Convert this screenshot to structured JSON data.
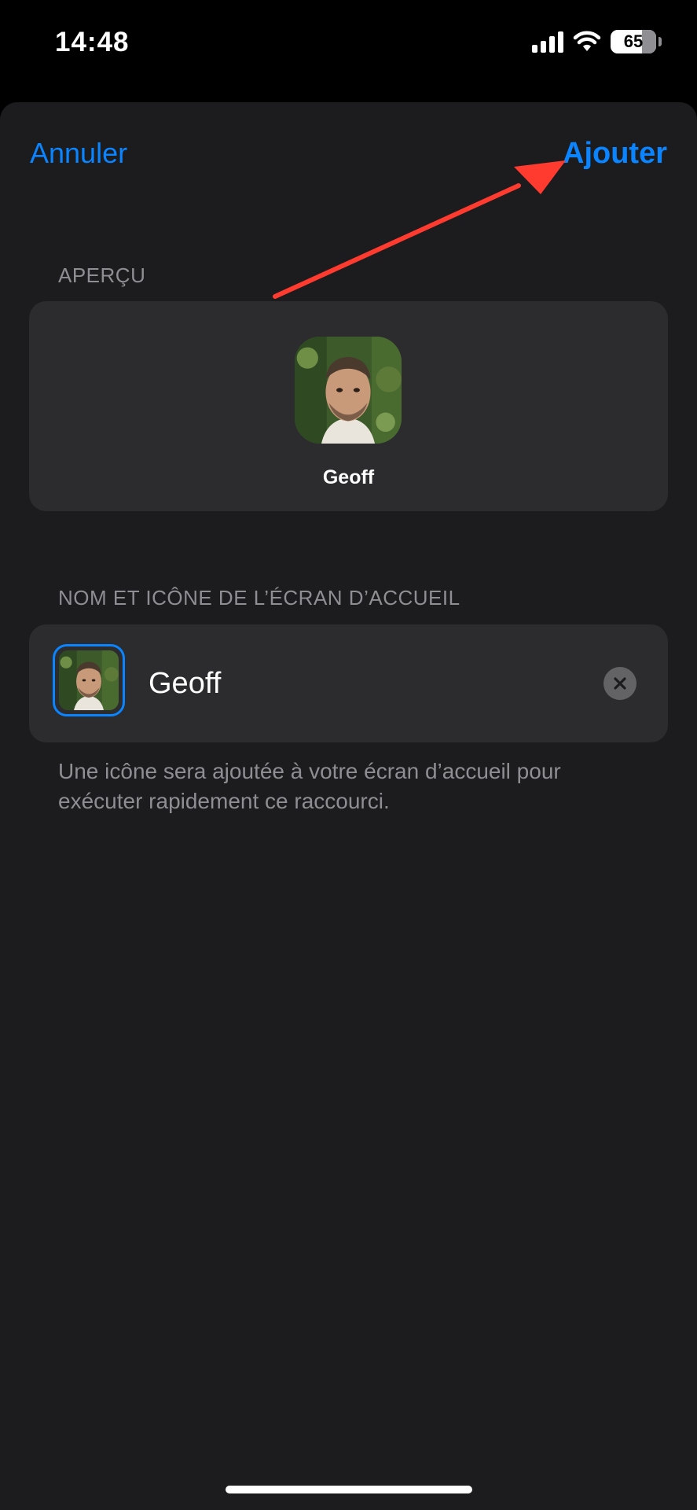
{
  "status_bar": {
    "time": "14:48",
    "battery": "65",
    "icons": [
      "cellular-signal-icon",
      "wifi-icon",
      "battery-icon"
    ]
  },
  "nav": {
    "cancel_label": "Annuler",
    "add_label": "Ajouter"
  },
  "preview": {
    "header": "APERÇU",
    "name": "Geoff"
  },
  "home_screen": {
    "header": "NOM ET ICÔNE DE L’ÉCRAN D’ACCUEIL",
    "name_value": "Geoff",
    "footer": "Une icône sera ajoutée à votre écran d’accueil pour exécuter rapidement ce raccourci."
  },
  "colors": {
    "accent": "#0a84ff",
    "annotation_arrow": "#ff3b30",
    "sheet_background": "#1c1c1e",
    "card_background": "#2c2c2e"
  }
}
